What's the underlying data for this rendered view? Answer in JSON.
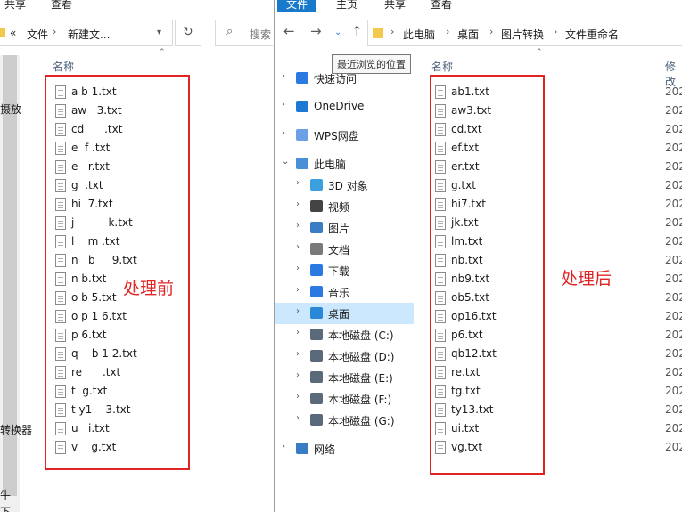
{
  "left_window": {
    "ribbon": {
      "share": "共享",
      "view": "查看"
    },
    "address": {
      "overflow": "«",
      "path": [
        "文件",
        "新建文..."
      ]
    },
    "search_placeholder": "搜索",
    "column_header": "名称",
    "clipped_text": [
      "摄放",
      "转换器",
      "牛",
      "下"
    ],
    "files": [
      "a b 1.txt",
      "aw   3.txt",
      "cd      .txt",
      "e  f .txt",
      "e   r.txt",
      "g  .txt",
      "hi  7.txt",
      "j          k.txt",
      "l    m .txt",
      "n   b     9.txt",
      "n b.txt",
      "o b 5.txt",
      "o p 1 6.txt",
      "p 6.txt",
      "q    b 1 2.txt",
      "re      .txt",
      "t  g.txt",
      "t y1    3.txt",
      "u   i.txt",
      "v    g.txt"
    ],
    "annotation": "处理前"
  },
  "right_window": {
    "ribbon": {
      "file": "文件",
      "home": "主页",
      "share": "共享",
      "view": "查看"
    },
    "address": {
      "path": [
        "此电脑",
        "桌面",
        "图片转换",
        "文件重命名"
      ]
    },
    "tooltip": "最近浏览的位置",
    "column_header_name": "名称",
    "column_header_modified": "修改",
    "nav_items": [
      {
        "label": "快速访问",
        "icon": "star-icon",
        "color": "#2a7ae2",
        "indent": 0
      },
      {
        "label": "OneDrive",
        "icon": "cloud-icon",
        "color": "#1f78d1",
        "indent": 0
      },
      {
        "label": "WPS网盘",
        "icon": "cloud-icon",
        "color": "#6aa0e6",
        "indent": 0
      },
      {
        "label": "此电脑",
        "icon": "computer-icon",
        "color": "#4a90d9",
        "indent": 0
      },
      {
        "label": "3D 对象",
        "icon": "cube-icon",
        "color": "#3aa0e0",
        "indent": 1
      },
      {
        "label": "视频",
        "icon": "film-icon",
        "color": "#444444",
        "indent": 1
      },
      {
        "label": "图片",
        "icon": "picture-icon",
        "color": "#3b7dc4",
        "indent": 1
      },
      {
        "label": "文档",
        "icon": "document-icon",
        "color": "#7a7a7a",
        "indent": 1
      },
      {
        "label": "下载",
        "icon": "download-arrow-icon",
        "color": "#2a7ae2",
        "indent": 1
      },
      {
        "label": "音乐",
        "icon": "music-note-icon",
        "color": "#2a7ae2",
        "indent": 1
      },
      {
        "label": "桌面",
        "icon": "desktop-icon",
        "color": "#2a88d8",
        "indent": 1,
        "selected": true
      },
      {
        "label": "本地磁盘 (C:)",
        "icon": "disk-c-icon",
        "color": "#5a6a7a",
        "indent": 1
      },
      {
        "label": "本地磁盘 (D:)",
        "icon": "disk-d-icon",
        "color": "#5a6a7a",
        "indent": 1
      },
      {
        "label": "本地磁盘 (E:)",
        "icon": "disk-e-icon",
        "color": "#5a6a7a",
        "indent": 1
      },
      {
        "label": "本地磁盘 (F:)",
        "icon": "disk-f-icon",
        "color": "#5a6a7a",
        "indent": 1
      },
      {
        "label": "本地磁盘 (G:)",
        "icon": "disk-g-icon",
        "color": "#5a6a7a",
        "indent": 1
      },
      {
        "label": "网络",
        "icon": "network-icon",
        "color": "#3a7cc4",
        "indent": 0
      }
    ],
    "files": [
      "ab1.txt",
      "aw3.txt",
      "cd.txt",
      "ef.txt",
      "er.txt",
      "g.txt",
      "hi7.txt",
      "jk.txt",
      "lm.txt",
      "nb.txt",
      "nb9.txt",
      "ob5.txt",
      "op16.txt",
      "p6.txt",
      "qb12.txt",
      "re.txt",
      "tg.txt",
      "ty13.txt",
      "ui.txt",
      "vg.txt"
    ],
    "modified_prefix": "202",
    "annotation": "处理后"
  },
  "colors": {
    "accent": "#1979ca",
    "annotation_red": "#e02424",
    "selection": "#cce8ff"
  }
}
